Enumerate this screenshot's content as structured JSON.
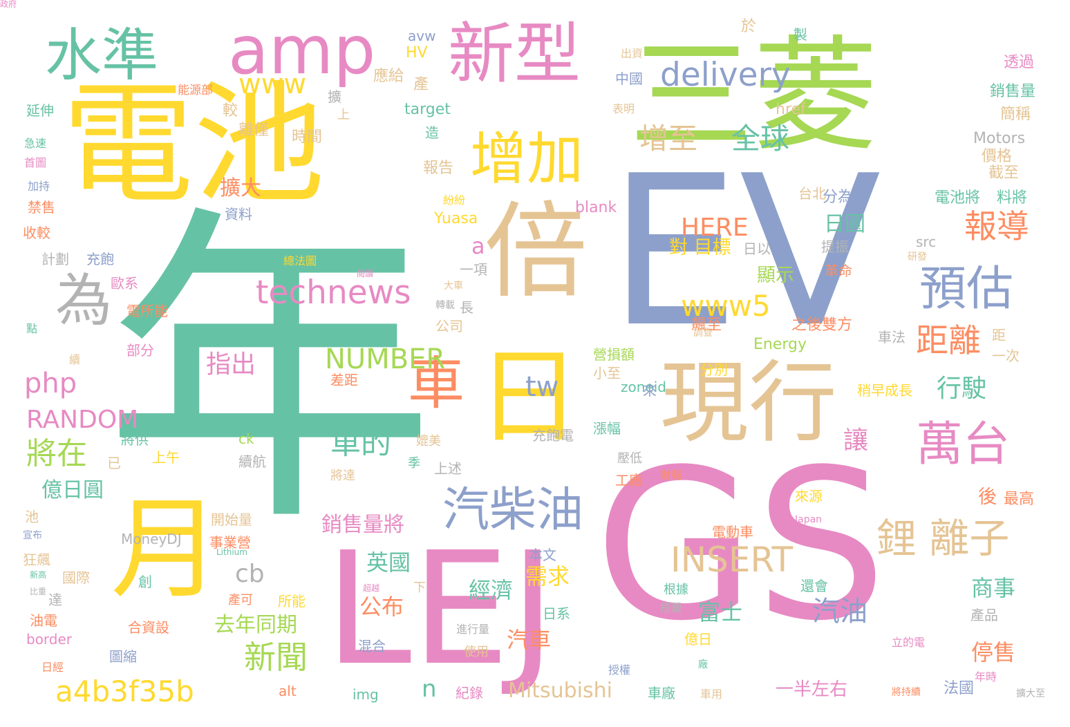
{
  "colors": {
    "green": "#a6d854",
    "teal": "#66c2a5",
    "orange": "#fc8d62",
    "blue": "#8da0cb",
    "pink": "#e78ac3",
    "yellow": "#ffd92f",
    "tan": "#e5c494",
    "gray": "#b3b3b3"
  },
  "words": [
    {
      "text": "年",
      "color": "teal"
    },
    {
      "text": "EV",
      "color": "blue"
    },
    {
      "text": "GS",
      "color": "pink"
    },
    {
      "text": "三菱",
      "color": "green"
    },
    {
      "text": "電池",
      "color": "yellow"
    },
    {
      "text": "LEJ",
      "color": "pink"
    },
    {
      "text": "倍",
      "color": "tan"
    },
    {
      "text": "日",
      "color": "yellow"
    },
    {
      "text": "月",
      "color": "yellow"
    },
    {
      "text": "現行",
      "color": "tan"
    },
    {
      "text": "新型",
      "color": "pink"
    },
    {
      "text": "amp",
      "color": "pink"
    },
    {
      "text": "水準",
      "color": "teal"
    },
    {
      "text": "增加",
      "color": "yellow"
    },
    {
      "text": "為",
      "color": "gray"
    },
    {
      "text": "車",
      "color": "orange"
    },
    {
      "text": "汽柴油",
      "color": "blue"
    },
    {
      "text": "萬台",
      "color": "pink"
    },
    {
      "text": "預估",
      "color": "blue"
    },
    {
      "text": "delivery",
      "color": "blue"
    },
    {
      "text": "鋰 離子",
      "color": "tan"
    },
    {
      "text": "technews",
      "color": "pink"
    },
    {
      "text": "INSERT",
      "color": "tan"
    },
    {
      "text": "a4b3f35b",
      "color": "yellow"
    },
    {
      "text": "www5",
      "color": "yellow"
    },
    {
      "text": "增至",
      "color": "tan"
    },
    {
      "text": "全球",
      "color": "teal"
    },
    {
      "text": "距離",
      "color": "orange"
    },
    {
      "text": "報導",
      "color": "orange"
    },
    {
      "text": "NUMBER",
      "color": "green"
    },
    {
      "text": "php",
      "color": "pink"
    },
    {
      "text": "RANDOM",
      "color": "pink"
    },
    {
      "text": "將在",
      "color": "green"
    },
    {
      "text": "車的",
      "color": "teal"
    },
    {
      "text": "www",
      "color": "yellow"
    },
    {
      "text": "tw",
      "color": "blue"
    },
    {
      "text": "指出",
      "color": "pink"
    },
    {
      "text": "新聞",
      "color": "green"
    },
    {
      "text": "cb",
      "color": "gray"
    },
    {
      "text": "HERE",
      "color": "orange"
    },
    {
      "text": "行駛",
      "color": "teal"
    },
    {
      "text": "汽油",
      "color": "blue"
    },
    {
      "text": "讓",
      "color": "pink"
    },
    {
      "text": "Mitsubishi",
      "color": "tan"
    },
    {
      "text": "n",
      "color": "teal"
    },
    {
      "text": "a",
      "color": "pink"
    },
    {
      "text": "去年同期",
      "color": "green"
    },
    {
      "text": "億日圓",
      "color": "teal"
    },
    {
      "text": "公布",
      "color": "orange"
    },
    {
      "text": "需求",
      "color": "yellow"
    },
    {
      "text": "汽車",
      "color": "orange"
    },
    {
      "text": "經濟",
      "color": "teal"
    },
    {
      "text": "富士",
      "color": "teal"
    },
    {
      "text": "商事",
      "color": "teal"
    },
    {
      "text": "停售",
      "color": "orange"
    },
    {
      "text": "英國",
      "color": "teal"
    },
    {
      "text": "銷售量將",
      "color": "pink"
    },
    {
      "text": "擴大",
      "color": "orange"
    },
    {
      "text": "日圓",
      "color": "teal"
    },
    {
      "text": "對 目標",
      "color": "yellow"
    },
    {
      "text": "顯示",
      "color": "green"
    },
    {
      "text": "後",
      "color": "orange"
    },
    {
      "text": "最高",
      "color": "orange"
    },
    {
      "text": "一半左右",
      "color": "pink"
    },
    {
      "text": "法國",
      "color": "blue"
    },
    {
      "text": "Energy",
      "color": "green"
    },
    {
      "text": "之後雙方",
      "color": "orange"
    },
    {
      "text": "飆至",
      "color": "orange"
    },
    {
      "text": "Yuasa",
      "color": "yellow"
    },
    {
      "text": "blank",
      "color": "pink"
    },
    {
      "text": "分為止",
      "color": "blue"
    },
    {
      "text": "電池將",
      "color": "teal"
    },
    {
      "text": "料將",
      "color": "teal"
    },
    {
      "text": "Motors",
      "color": "gray"
    },
    {
      "text": "價格",
      "color": "tan"
    },
    {
      "text": "截至",
      "color": "tan"
    },
    {
      "text": "target",
      "color": "teal"
    },
    {
      "text": "href",
      "color": "tan"
    },
    {
      "text": "銷售量",
      "color": "teal"
    },
    {
      "text": "簡稱",
      "color": "tan"
    },
    {
      "text": "透過",
      "color": "pink"
    },
    {
      "text": "製",
      "color": "teal"
    },
    {
      "text": "於",
      "color": "tan"
    },
    {
      "text": "avw",
      "color": "blue"
    },
    {
      "text": "HV",
      "color": "yellow"
    },
    {
      "text": "應給",
      "color": "tan"
    },
    {
      "text": "產",
      "color": "tan"
    },
    {
      "text": "擴",
      "color": "gray"
    },
    {
      "text": "上",
      "color": "tan"
    },
    {
      "text": "較",
      "color": "tan"
    },
    {
      "text": "離僅",
      "color": "tan"
    },
    {
      "text": "時間",
      "color": "tan"
    },
    {
      "text": "造",
      "color": "teal"
    },
    {
      "text": "報告",
      "color": "tan"
    },
    {
      "text": "出資",
      "color": "tan"
    },
    {
      "text": "中國",
      "color": "blue"
    },
    {
      "text": "表明",
      "color": "tan"
    },
    {
      "text": "能源部",
      "color": "orange"
    },
    {
      "text": "延伸",
      "color": "teal"
    },
    {
      "text": "急速",
      "color": "teal"
    },
    {
      "text": "首圖",
      "color": "pink"
    },
    {
      "text": "加持",
      "color": "blue"
    },
    {
      "text": "禁售",
      "color": "orange"
    },
    {
      "text": "收較",
      "color": "orange"
    },
    {
      "text": "計劃",
      "color": "gray"
    },
    {
      "text": "充飽",
      "color": "blue"
    },
    {
      "text": "資料",
      "color": "blue"
    },
    {
      "text": "歐系",
      "color": "pink"
    },
    {
      "text": "電所能",
      "color": "orange"
    },
    {
      "text": "部分",
      "color": "pink"
    },
    {
      "text": "點",
      "color": "teal"
    },
    {
      "text": "續",
      "color": "tan"
    },
    {
      "text": "紛紛",
      "color": "yellow"
    },
    {
      "text": "總法圖",
      "color": "yellow"
    },
    {
      "text": "閱讀",
      "color": "pink"
    },
    {
      "text": "一項",
      "color": "gray"
    },
    {
      "text": "大車",
      "color": "tan"
    },
    {
      "text": "轉載",
      "color": "gray"
    },
    {
      "text": "長",
      "color": "gray"
    },
    {
      "text": "公司",
      "color": "tan"
    },
    {
      "text": "台北",
      "color": "tan"
    },
    {
      "text": "src",
      "color": "gray"
    },
    {
      "text": "日以",
      "color": "gray"
    },
    {
      "text": "提振",
      "color": "gray"
    },
    {
      "text": "研發",
      "color": "tan"
    },
    {
      "text": "革命",
      "color": "orange"
    },
    {
      "text": "調查",
      "color": "tan"
    },
    {
      "text": "車法",
      "color": "gray"
    },
    {
      "text": "距",
      "color": "tan"
    },
    {
      "text": "一次",
      "color": "tan"
    },
    {
      "text": "分別",
      "color": "yellow"
    },
    {
      "text": "營損額",
      "color": "green"
    },
    {
      "text": "小至",
      "color": "tan"
    },
    {
      "text": "zoneid",
      "color": "teal"
    },
    {
      "text": "來",
      "color": "blue"
    },
    {
      "text": "差距",
      "color": "orange"
    },
    {
      "text": "稍早成長",
      "color": "yellow"
    },
    {
      "text": "漲幅",
      "color": "teal"
    },
    {
      "text": "充飽電",
      "color": "gray"
    },
    {
      "text": "媲美",
      "color": "tan"
    },
    {
      "text": "季",
      "color": "teal"
    },
    {
      "text": "ck",
      "color": "green"
    },
    {
      "text": "續航",
      "color": "gray"
    },
    {
      "text": "將供",
      "color": "teal"
    },
    {
      "text": "上午",
      "color": "yellow"
    },
    {
      "text": "已",
      "color": "tan"
    },
    {
      "text": "上述",
      "color": "gray"
    },
    {
      "text": "壓低",
      "color": "gray"
    },
    {
      "text": "工廠",
      "color": "orange"
    },
    {
      "text": "財報",
      "color": "orange"
    },
    {
      "text": "將達",
      "color": "tan"
    },
    {
      "text": "來源",
      "color": "yellow"
    },
    {
      "text": "池",
      "color": "tan"
    },
    {
      "text": "開始量",
      "color": "tan"
    },
    {
      "text": "Japan",
      "color": "pink"
    },
    {
      "text": "宣布",
      "color": "blue"
    },
    {
      "text": "MoneyDJ",
      "color": "gray"
    },
    {
      "text": "事業營",
      "color": "orange"
    },
    {
      "text": "Lithium",
      "color": "teal"
    },
    {
      "text": "狂飆",
      "color": "tan"
    },
    {
      "text": "本文",
      "color": "blue"
    },
    {
      "text": "電動車",
      "color": "orange"
    },
    {
      "text": "新高",
      "color": "teal"
    },
    {
      "text": "國際",
      "color": "tan"
    },
    {
      "text": "創",
      "color": "teal"
    },
    {
      "text": "比重",
      "color": "gray"
    },
    {
      "text": "下",
      "color": "tan"
    },
    {
      "text": "超越",
      "color": "pink"
    },
    {
      "text": "還會",
      "color": "teal"
    },
    {
      "text": "達",
      "color": "gray"
    },
    {
      "text": "產可",
      "color": "orange"
    },
    {
      "text": "所能",
      "color": "yellow"
    },
    {
      "text": "根據",
      "color": "teal"
    },
    {
      "text": "搭載",
      "color": "gray"
    },
    {
      "text": "油電",
      "color": "orange"
    },
    {
      "text": "日系",
      "color": "teal"
    },
    {
      "text": "產品",
      "color": "gray"
    },
    {
      "text": "合資設",
      "color": "orange"
    },
    {
      "text": "進行量",
      "color": "gray"
    },
    {
      "text": "億日",
      "color": "yellow"
    },
    {
      "text": "border",
      "color": "pink"
    },
    {
      "text": "混合",
      "color": "blue"
    },
    {
      "text": "立的電",
      "color": "pink"
    },
    {
      "text": "圖縮",
      "color": "blue"
    },
    {
      "text": "使用",
      "color": "tan"
    },
    {
      "text": "年時",
      "color": "pink"
    },
    {
      "text": "日經",
      "color": "orange"
    },
    {
      "text": "廠",
      "color": "teal"
    },
    {
      "text": "授權",
      "color": "blue"
    },
    {
      "text": "alt",
      "color": "orange"
    },
    {
      "text": "img",
      "color": "teal"
    },
    {
      "text": "紀錄",
      "color": "pink"
    },
    {
      "text": "車廠",
      "color": "teal"
    },
    {
      "text": "車用",
      "color": "tan"
    },
    {
      "text": "將持續",
      "color": "orange"
    },
    {
      "text": "擴大至",
      "color": "gray"
    },
    {
      "text": "政府",
      "color": "pink"
    }
  ]
}
